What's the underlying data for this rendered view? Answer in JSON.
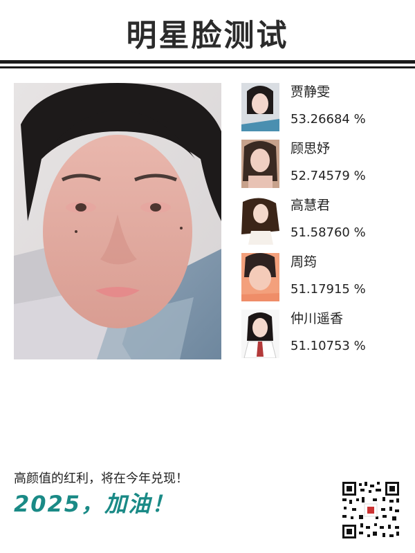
{
  "title": "明星脸测试",
  "matches": [
    {
      "name": "贾静雯",
      "score": "53.26684 %",
      "icon": "celebrity-photo"
    },
    {
      "name": "顾思妤",
      "score": "52.74579 %",
      "icon": "celebrity-photo"
    },
    {
      "name": "高慧君",
      "score": "51.58760 %",
      "icon": "celebrity-photo"
    },
    {
      "name": "周筠",
      "score": "51.17915 %",
      "icon": "celebrity-photo"
    },
    {
      "name": "仲川遥香",
      "score": "51.10753 %",
      "icon": "celebrity-photo"
    }
  ],
  "footer": {
    "slogan": "高颜值的红利，将在今年兑现！",
    "cheer": "2025，加油！",
    "qr_icon": "qr-code-icon"
  },
  "colors": {
    "accent": "#1a8a86",
    "rule": "#1b1b1b"
  }
}
